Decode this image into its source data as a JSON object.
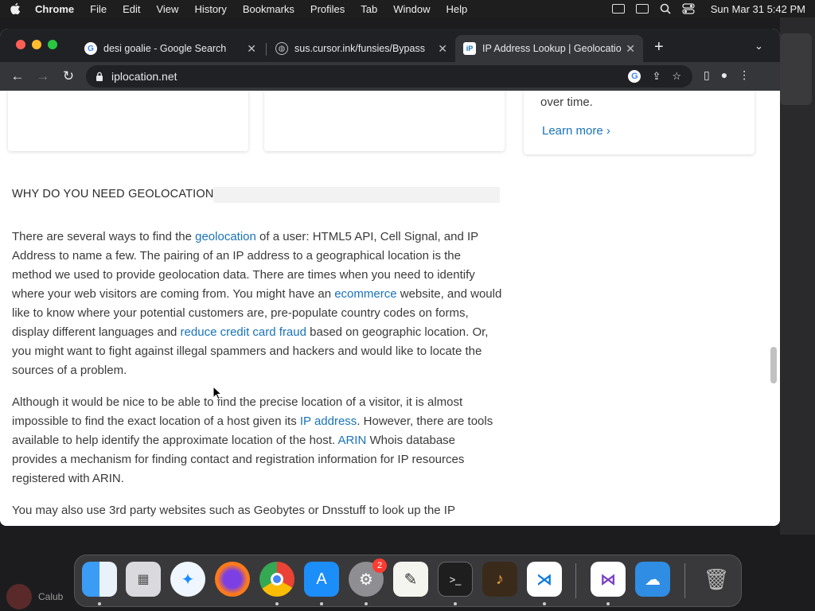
{
  "menubar": {
    "app": "Chrome",
    "items": [
      "File",
      "Edit",
      "View",
      "History",
      "Bookmarks",
      "Profiles",
      "Tab",
      "Window",
      "Help"
    ],
    "clock": "Sun Mar 31  5:42 PM"
  },
  "tabs": [
    {
      "title": "desi goalie - Google Search",
      "favicon": "google-icon"
    },
    {
      "title": "sus.cursor.ink/funsies/Bypass",
      "favicon": "globe-icon"
    },
    {
      "title": "IP Address Lookup | Geolocatio",
      "favicon": "iplocation-icon"
    }
  ],
  "address_bar": {
    "url": "iplocation.net"
  },
  "page": {
    "sidebar_card": {
      "text": "over time.",
      "link": "Learn more"
    },
    "section_title": "WHY DO YOU NEED GEOLOCATION?",
    "p1": {
      "t1": "There are several ways to find the ",
      "l1": "geolocation",
      "t2": " of a user: HTML5 API, Cell Signal, and IP Address to name a few. The pairing of an IP address to a geographical location is the method we used to provide geolocation data. There are times when you need to identify where your web visitors are coming from. You might have an ",
      "l2": "ecommerce",
      "t3": " website, and would like to know where your potential customers are, pre-populate country codes on forms, display different languages and ",
      "l3": "reduce credit card fraud",
      "t4": " based on geographic location. Or, you might want to fight against illegal spammers and hackers and would like to locate the sources of a problem."
    },
    "p2": {
      "t1": "Although it would be nice to be able to find the precise location of a visitor, it is almost impossible to find the exact location of a host given its ",
      "l1": "IP address",
      "t2": ". However, there are tools available to help identify the approximate location of the host. ",
      "l2": "ARIN",
      "t3": " Whois database provides a mechanism for finding contact and registration information for IP resources registered with ARIN."
    },
    "p3": {
      "t1": "You may also use 3rd party websites such as Geobytes or Dnsstuff to look up the IP"
    }
  },
  "dock": {
    "apps": [
      "finder-icon",
      "launchpad-icon",
      "safari-icon",
      "firefox-icon",
      "chrome-icon",
      "app-store-icon",
      "system-settings-icon",
      "textedit-icon",
      "terminal-icon",
      "garageband-icon",
      "vscode-icon",
      "visual-studio-icon",
      "weather-icon",
      "trash-icon"
    ],
    "settings_badge": "2"
  },
  "desktop": {
    "user_label": "Calub"
  },
  "colors": {
    "link": "#1a73b8",
    "tab_active": "#35363a",
    "tab_bar": "#202124"
  }
}
